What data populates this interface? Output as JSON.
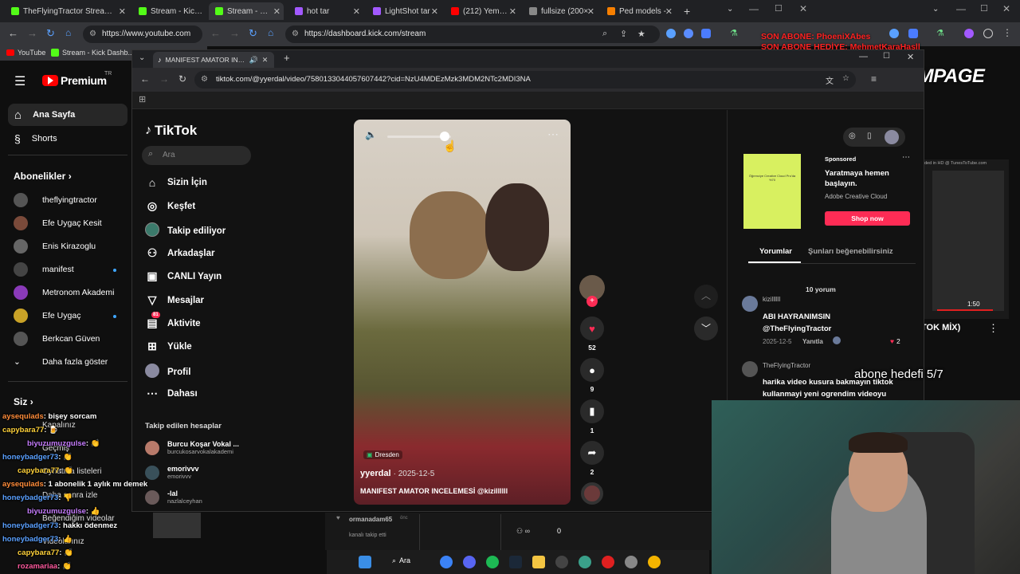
{
  "tabs": [
    {
      "label": "TheFlyingTractor Stream - Watc",
      "color": "#53fc18"
    },
    {
      "label": "Stream - Kick Dash",
      "color": "#53fc18"
    },
    {
      "label": "Stream - Kick",
      "color": "#53fc18",
      "active": true
    },
    {
      "label": "hot tar",
      "color": "#a259ff"
    },
    {
      "label": "LightShot tar",
      "color": "#a259ff"
    },
    {
      "label": "(212) Yemekte",
      "color": "#ff0000"
    },
    {
      "label": "fullsize (200×",
      "color": "#888888"
    },
    {
      "label": "Ped models -",
      "color": "#f77f00"
    }
  ],
  "yt_url": "https://www.youtube.com",
  "kick_url": "https://dashboard.kick.com/stream",
  "bookmarks": {
    "yt": "YouTube",
    "kick": "Stream - Kick Dashb..."
  },
  "overlay": {
    "sub_line1": "SON ABONE: PhoeniXAbes",
    "sub_line2": "SON ABONE HEDİYE: MehmetKaraHasll",
    "rampage": "RAMPAGE",
    "goal": "abone hedefi 5/7",
    "mix_label": "TOK MİX)",
    "mix_time": "1:50",
    "hd_text": "ded in HD @ TunesToTube.com"
  },
  "yt_side": {
    "logo": "Premium",
    "tr": "TR",
    "home": "Ana Sayfa",
    "shorts": "Shorts",
    "subs_header": "Abonelikler",
    "subs": [
      {
        "name": "theflyingtractor",
        "dot": false,
        "color": "#555"
      },
      {
        "name": "Efe Uygaç Kesit",
        "dot": false,
        "color": "#7a4a3a"
      },
      {
        "name": "Enis Kirazoglu",
        "dot": false,
        "color": "#666"
      },
      {
        "name": "manifest",
        "dot": true,
        "color": "#444"
      },
      {
        "name": "Metronom Akademi",
        "dot": false,
        "color": "#8a3ab9"
      },
      {
        "name": "Efe Uygaç",
        "dot": true,
        "color": "#c9a227"
      },
      {
        "name": "Berkcan Güven",
        "dot": false,
        "color": "#555"
      }
    ],
    "more": "Daha fazla göster",
    "you": "Siz",
    "you_items": [
      "Kanalınız",
      "Geçmiş",
      "Oynatma listeleri",
      "Daha sonra izle",
      "Beğendiğim videolar",
      "Videolarınız"
    ]
  },
  "chat": [
    {
      "user": "aysequlads",
      "msg": ": bişey sorcam",
      "color": "#ff8c3a"
    },
    {
      "user": "capybara77",
      "msg": ": 🍺",
      "color": "#ffd23a"
    },
    {
      "user": "biyuzumuzgulse",
      "msg": ": 👏",
      "color": "#c77dff"
    },
    {
      "user": "honeybadger73",
      "msg": ": 👏",
      "color": "#5aa0ff"
    },
    {
      "user": "capybara77",
      "msg": ": 👏",
      "color": "#ffd23a"
    },
    {
      "user": "aysequlads",
      "msg": ": 1 abonelik 1 aylık mı demek",
      "color": "#ff8c3a"
    },
    {
      "user": "honeybadger73",
      "msg": ": 👎",
      "color": "#5aa0ff"
    },
    {
      "user": "biyuzumuzgulse",
      "msg": ": 👍",
      "color": "#c77dff"
    },
    {
      "user": "honeybadger73",
      "msg": ": hakkı ödenmez",
      "color": "#5aa0ff"
    },
    {
      "user": "honeybadger73",
      "msg": ": 👍",
      "color": "#5aa0ff"
    },
    {
      "user": "capybara77",
      "msg": ": 👏",
      "color": "#ffd23a"
    },
    {
      "user": "rozamariaa",
      "msg": ": 👏",
      "color": "#ff5a9e"
    }
  ],
  "tt": {
    "win_tab": "MANIFEST AMATOR INCELE",
    "url": "tiktok.com/@yyerdal/video/7580133044057607442?cid=NzU4MDEzMzk3MDM2NTc2MDI3NA",
    "logo": "TikTok",
    "search_placeholder": "Ara",
    "nav": [
      "Sizin İçin",
      "Keşfet",
      "Takip ediliyor",
      "Arkadaşlar",
      "CANLI Yayın",
      "Mesajlar",
      "Aktivite",
      "Yükle",
      "Profil",
      "Dahası"
    ],
    "nav_badge": "81",
    "following_header": "Takip edilen hesaplar",
    "following": [
      {
        "name": "Burcu Koşar Vokal ...",
        "handle": "burcukosarvokalakademi"
      },
      {
        "name": "emorivvv",
        "handle": "emorivvv"
      },
      {
        "name": "-lal",
        "handle": "nazlalceyhan"
      }
    ],
    "video": {
      "location": "Dresden",
      "author": "yyerdal",
      "date": "· 2025-12-5",
      "caption": "MANIFEST AMATOR INCELEMESİ @kizillllll"
    },
    "actions": {
      "likes": "52",
      "comments": "9",
      "saves": "1",
      "shares": "2"
    },
    "ad": {
      "label": "Sponsored",
      "title": "Yaratmaya hemen başlayın.",
      "brand": "Adobe Creative Cloud",
      "cta": "Shop now",
      "poster": "Öğrenciye Creative Cloud Pro'da %70"
    },
    "tabs": {
      "comments": "Yorumlar",
      "suggest": "Şunları beğenebilirsiniz"
    },
    "count": "10 yorum",
    "comments": [
      {
        "user": "kizillllll",
        "text": "ABI HAYRANIMSIN @TheFlyingTractor",
        "date": "2025-12-5",
        "reply": "Yanıtla",
        "likes": "2"
      },
      {
        "user": "TheFlyingTractor",
        "text": "harika video kusura bakmayın tiktok kullanmayi yeni ogrendim videoyu",
        "date": "",
        "reply": "",
        "likes": ""
      }
    ],
    "bg_user": "ormanadam65",
    "bg_sub": "kanalı takip etti",
    "bg_viewers": "0",
    "bg_time": "önc"
  },
  "taskbar": {
    "search": "Ara"
  }
}
